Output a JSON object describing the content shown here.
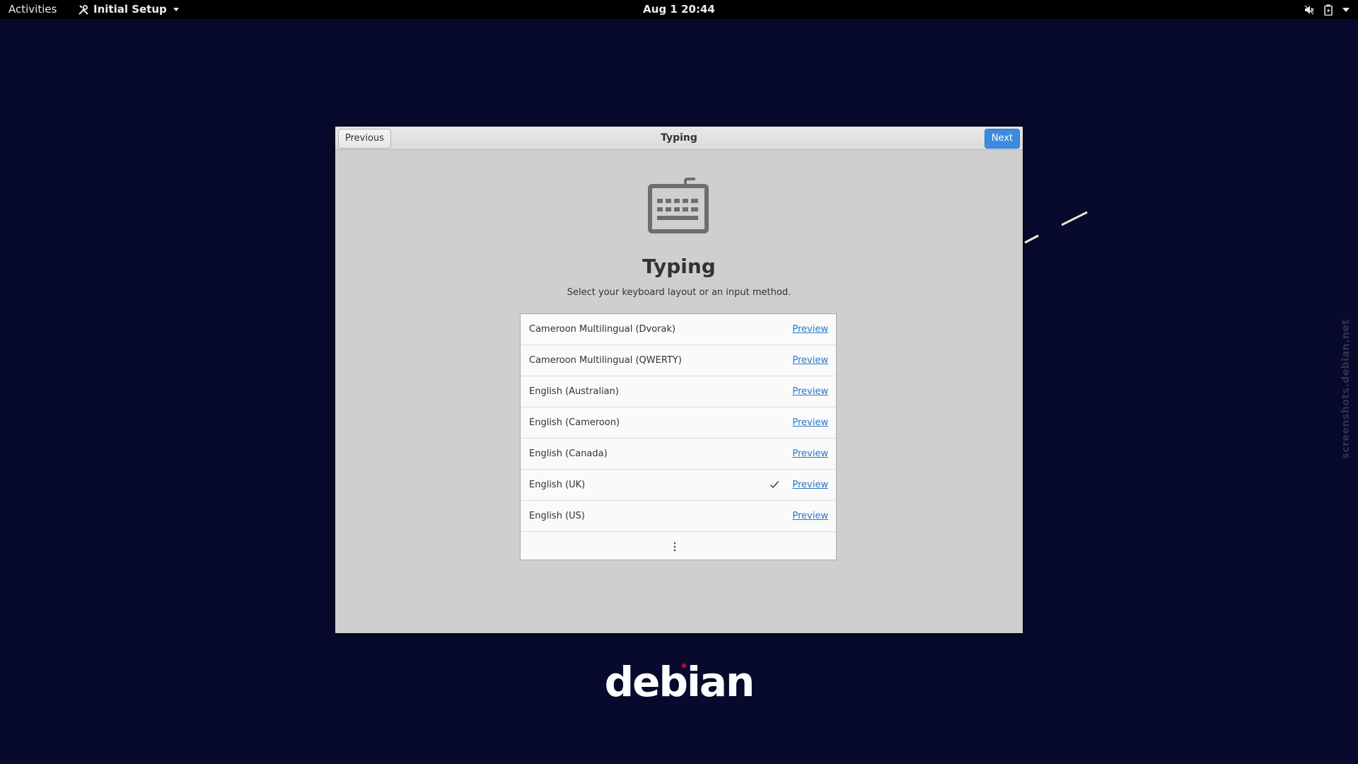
{
  "topbar": {
    "activities": "Activities",
    "app_name": "Initial Setup",
    "clock": "Aug 1  20:44",
    "icons": [
      "tools-icon",
      "volume-muted-icon",
      "battery-icon",
      "system-menu-arrow-icon"
    ]
  },
  "dialog": {
    "header_title": "Typing",
    "previous_label": "Previous",
    "next_label": "Next",
    "icon": "keyboard-icon",
    "title": "Typing",
    "subtitle": "Select your keyboard layout or an input method.",
    "layouts": [
      {
        "label": "Cameroon Multilingual (Dvorak)",
        "preview": "Preview",
        "selected": false
      },
      {
        "label": "Cameroon Multilingual (QWERTY)",
        "preview": "Preview",
        "selected": false
      },
      {
        "label": "English (Australian)",
        "preview": "Preview",
        "selected": false
      },
      {
        "label": "English (Cameroon)",
        "preview": "Preview",
        "selected": false
      },
      {
        "label": "English (Canada)",
        "preview": "Preview",
        "selected": false
      },
      {
        "label": "English (UK)",
        "preview": "Preview",
        "selected": true
      },
      {
        "label": "English (US)",
        "preview": "Preview",
        "selected": false
      }
    ],
    "more_icon": "view-more-icon"
  },
  "branding": {
    "logo_text": "debian",
    "watermark": "screenshots.debian.net"
  },
  "colors": {
    "desktop_bg": "#070a2c",
    "dialog_bg": "#cfcfcf",
    "accent": "#3d8be0",
    "link": "#2a76c6",
    "debian_red": "#c70036"
  }
}
